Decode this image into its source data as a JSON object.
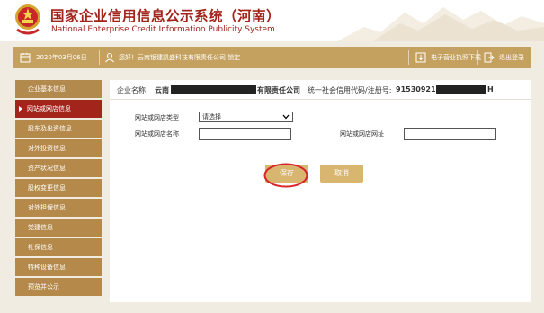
{
  "header": {
    "title_cn": "国家企业信用信息公示系统（河南）",
    "title_en": "National Enterprise Credit Information Publicity System"
  },
  "infobar": {
    "date": "2020年03月06日",
    "welcome": "您好！云南银建凯盛科技有限责任公司   锁定",
    "download_label": "电子营业执照下载",
    "exit_label": "退出登录"
  },
  "sidebar": {
    "items": [
      {
        "label": "企业基本信息",
        "active": false
      },
      {
        "label": "网站或网店信息",
        "active": true
      },
      {
        "label": "股东及出资信息",
        "active": false
      },
      {
        "label": "对外投资信息",
        "active": false
      },
      {
        "label": "资产状况信息",
        "active": false
      },
      {
        "label": "股权变更信息",
        "active": false
      },
      {
        "label": "对外担保信息",
        "active": false
      },
      {
        "label": "党建信息",
        "active": false
      },
      {
        "label": "社保信息",
        "active": false
      },
      {
        "label": "特种设备信息",
        "active": false
      },
      {
        "label": "预览并公示",
        "active": false
      }
    ]
  },
  "main": {
    "company_label": "企业名称:",
    "company_name": "云南",
    "company_name_suffix": "有限责任公司",
    "credit_label": "统一社会信用代码/注册号:",
    "credit_code": "91530921",
    "credit_code_suffix": "H",
    "form": {
      "type_label": "网站或网店类型",
      "type_value": "请选择",
      "name_label": "网站或网店名称",
      "name_value": "",
      "url_label": "网站或网店网址",
      "url_value": ""
    },
    "save_label": "保存",
    "cancel_label": "取消"
  },
  "colors": {
    "brand_red": "#a3241b",
    "gold": "#c4a15f",
    "sidebar": "#b5894a",
    "button": "#d9b670",
    "highlight_circle": "#d8262b"
  }
}
